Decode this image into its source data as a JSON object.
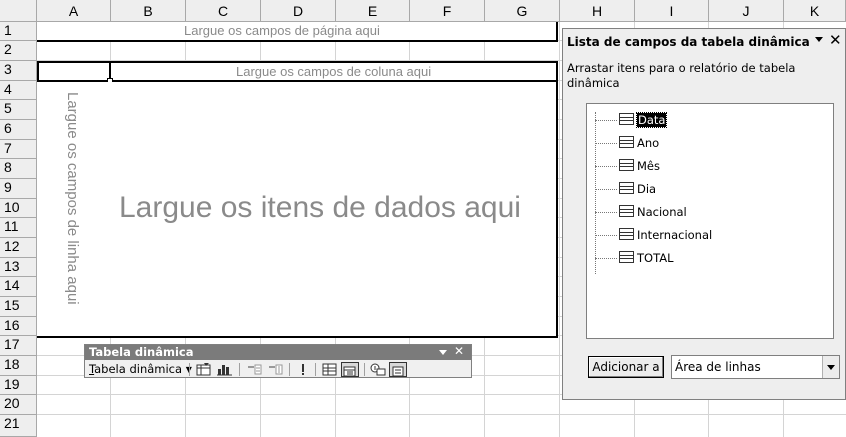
{
  "columns": [
    "A",
    "B",
    "C",
    "D",
    "E",
    "F",
    "G",
    "H",
    "I",
    "J",
    "K"
  ],
  "rows": [
    "1",
    "2",
    "3",
    "4",
    "5",
    "6",
    "7",
    "8",
    "9",
    "10",
    "11",
    "12",
    "13",
    "14",
    "15",
    "16",
    "17",
    "18",
    "19",
    "20",
    "21"
  ],
  "pivot": {
    "page_drop": "Largue os campos de página aqui",
    "column_drop": "Largue os campos de coluna aqui",
    "row_drop": "Largue os campos de linha aqui",
    "data_drop": "Largue os itens de dados aqui"
  },
  "field_list": {
    "title": "Lista de campos da tabela dinâmica",
    "description": "Arrastar itens para o relatório de tabela dinâmica",
    "fields": [
      "Data",
      "Ano",
      "Mês",
      "Dia",
      "Nacional",
      "Internacional",
      "TOTAL"
    ],
    "add_button": "Adicionar a",
    "area_select": "Área de linhas"
  },
  "toolbar": {
    "title": "Tabela dinâmica",
    "menu_label": "Tabela dinâmica",
    "menu_accel": "T",
    "menu_rest": "abela dinâmica"
  },
  "icons": [
    "dropdown-arrow-icon",
    "close-icon",
    "format-report-icon",
    "chart-wizard-icon",
    "hide-detail-icon",
    "show-detail-icon",
    "refresh-icon",
    "include-hidden-items-icon",
    "field-settings-icon",
    "show-field-list-icon",
    "always-display-items-icon",
    "field-icon"
  ]
}
